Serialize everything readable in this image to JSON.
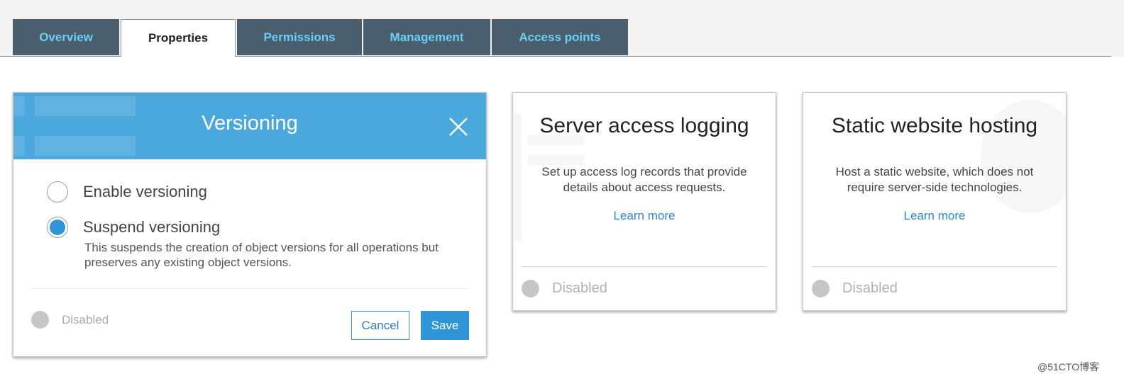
{
  "tabs": [
    {
      "label": "Overview",
      "active": false
    },
    {
      "label": "Properties",
      "active": true
    },
    {
      "label": "Permissions",
      "active": false
    },
    {
      "label": "Management",
      "active": false
    },
    {
      "label": "Access points",
      "active": false
    }
  ],
  "versioning": {
    "title": "Versioning",
    "options": [
      {
        "label": "Enable versioning",
        "selected": false
      },
      {
        "label": "Suspend versioning",
        "selected": true
      }
    ],
    "suspend_description": "This suspends the creation of object versions for all operations but preserves any existing object versions.",
    "status": "Disabled",
    "cancel_label": "Cancel",
    "save_label": "Save"
  },
  "cards": {
    "logging": {
      "title": "Server access logging",
      "description": "Set up access log records that provide details about access requests.",
      "link": "Learn more",
      "status": "Disabled"
    },
    "hosting": {
      "title": "Static website hosting",
      "description": "Host a static website, which does not require server-side technologies.",
      "link": "Learn more",
      "status": "Disabled"
    }
  },
  "watermark": "@51CTO博客",
  "colors": {
    "tab_bg": "#4a5e6e",
    "tab_text": "#6ad0f5",
    "modal_header": "#4aa8dc",
    "primary": "#2f95d6",
    "status_dot": "#c6c6c6"
  }
}
